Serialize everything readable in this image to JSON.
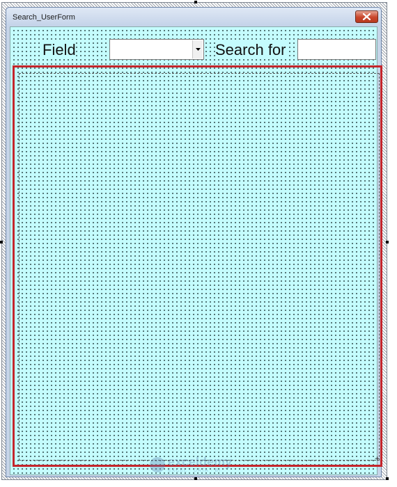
{
  "window": {
    "title": "Search_UserForm"
  },
  "form": {
    "field_label": "Field",
    "search_label": "Search for",
    "field_combo_value": "",
    "search_text_value": ""
  },
  "watermark": {
    "name": "exceldemy",
    "tagline": "EXCEL · DATA · BI"
  },
  "colors": {
    "form_background": "#c4fcfd",
    "highlight_border": "#c4252b",
    "close_button": "#c9462b"
  }
}
